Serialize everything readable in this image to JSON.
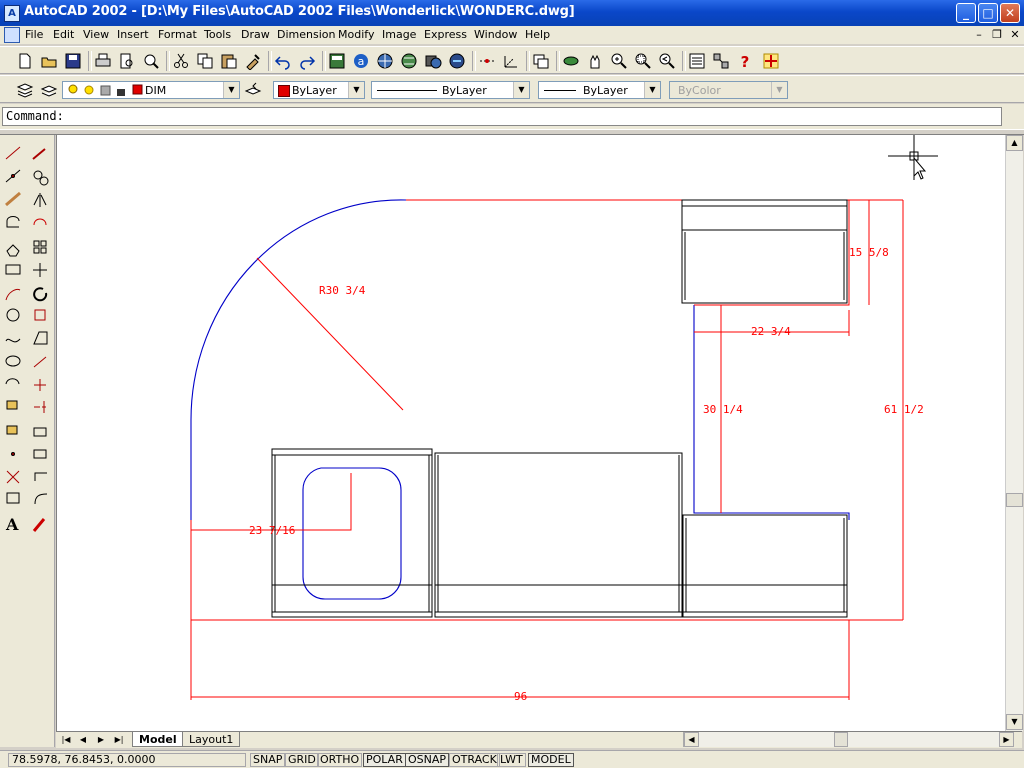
{
  "window": {
    "title": "AutoCAD 2002 - [D:\\My Files\\AutoCAD 2002  Files\\Wonderlick\\WONDERC.dwg]"
  },
  "menu": {
    "items": [
      "File",
      "Edit",
      "View",
      "Insert",
      "Format",
      "Tools",
      "Draw",
      "Dimension",
      "Modify",
      "Image",
      "Express",
      "Window",
      "Help"
    ]
  },
  "properties_toolbar": {
    "layer": "DIM",
    "color": "ByLayer",
    "linetype": "ByLayer",
    "lineweight": "ByLayer",
    "plotstyle": "ByColor",
    "accent_color": "#e00000"
  },
  "command": {
    "prompt": "Command:"
  },
  "drawing": {
    "colors": {
      "dimension": "#ff0000",
      "outline": "#0000c8",
      "cabinet": "#000000"
    },
    "dimensions": {
      "radius": "R30 3/4",
      "cabinet_height": "15 5/8",
      "cabinet_width": "22 3/4",
      "notch_depth": "30 1/4",
      "overall_depth": "61 1/2",
      "sink_offset": "23 7/16",
      "overall_width": "96"
    }
  },
  "tabs": {
    "model": "Model",
    "layout": "Layout1"
  },
  "status": {
    "coordinates": "78.5978, 76.8453, 0.0000",
    "buttons": [
      {
        "label": "SNAP",
        "on": false
      },
      {
        "label": "GRID",
        "on": false
      },
      {
        "label": "ORTHO",
        "on": false
      },
      {
        "label": "POLAR",
        "on": true
      },
      {
        "label": "OSNAP",
        "on": true
      },
      {
        "label": "OTRACK",
        "on": false
      },
      {
        "label": "LWT",
        "on": false
      },
      {
        "label": "MODEL",
        "on": true
      }
    ]
  }
}
